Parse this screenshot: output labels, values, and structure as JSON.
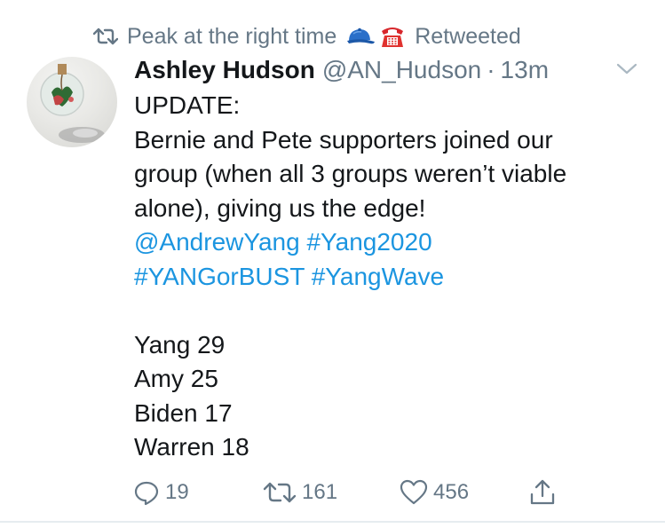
{
  "retweet_context": {
    "text": "Peak at the right time",
    "emoji": [
      "cap-emoji",
      "telephone-emoji"
    ],
    "status": "Retweeted"
  },
  "tweet": {
    "display_name": "Ashley Hudson",
    "handle": "@AN_Hudson",
    "separator": "·",
    "time": "13m",
    "lines": {
      "l1": "UPDATE:",
      "l2": "Bernie and Pete supporters joined our",
      "l3": "group (when all 3 groups weren’t viable",
      "l4": "alone), giving us the edge!",
      "mention": "@AndrewYang",
      "tag1": "#Yang2020",
      "tag2": "#YANGorBUST",
      "tag3": "#YangWave",
      "r1": "Yang 29",
      "r2": "Amy 25",
      "r3": "Biden 17",
      "r4": "Warren 18"
    }
  },
  "actions": {
    "replies": "19",
    "retweets": "161",
    "likes": "456"
  },
  "colors": {
    "text": "#14171a",
    "muted": "#657786",
    "link": "#1b95e0",
    "divider": "#e6ecf0"
  },
  "icons": [
    "retweet-icon",
    "chevron-down-icon",
    "reply-icon",
    "retweet-action-icon",
    "like-icon",
    "share-icon"
  ]
}
